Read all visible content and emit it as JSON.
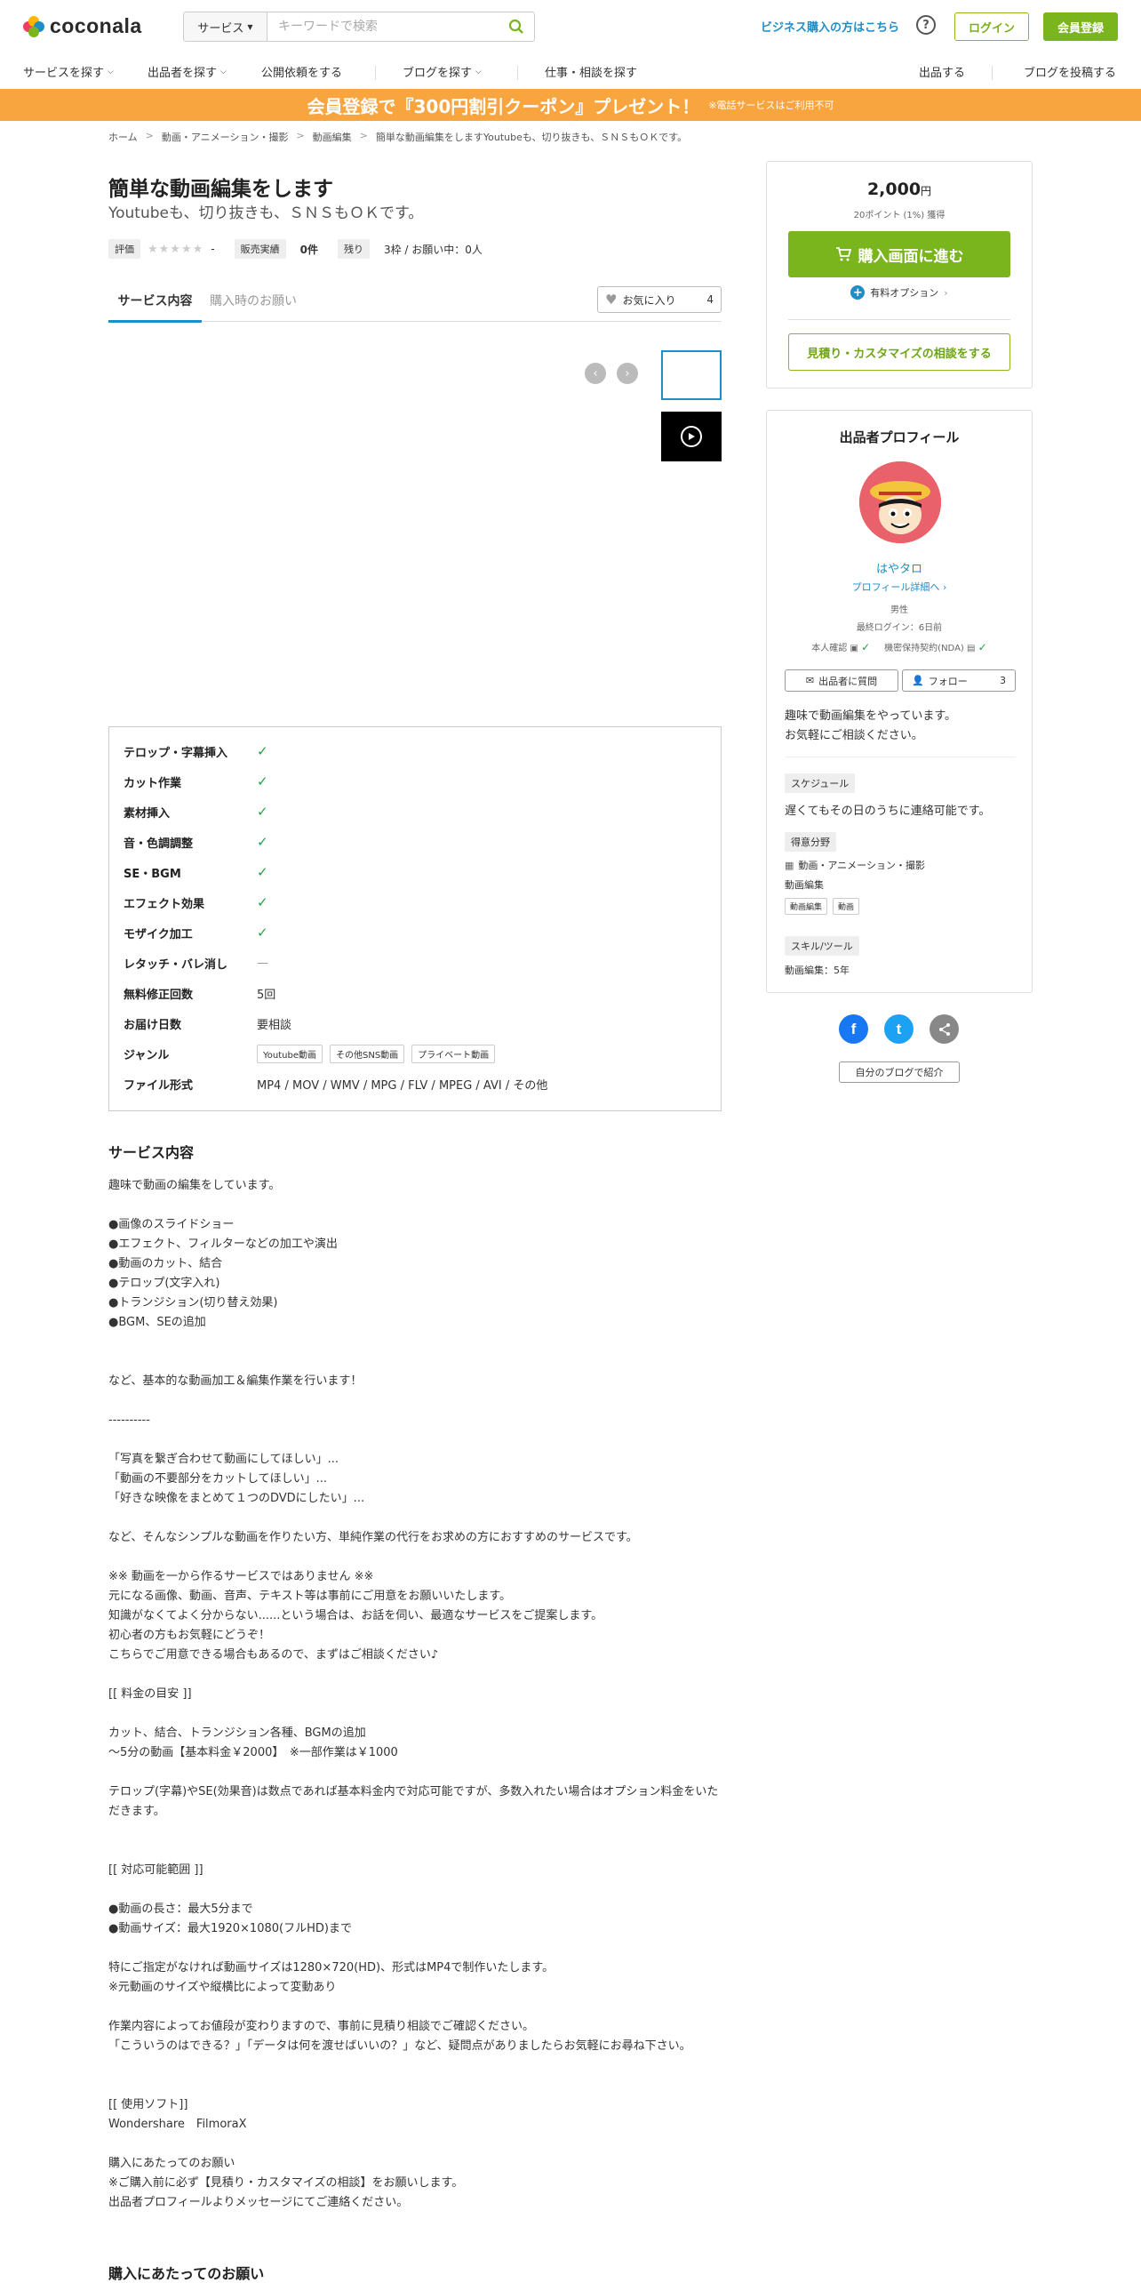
{
  "header": {
    "logo_text": "coconala",
    "search_category": "サービス",
    "search_placeholder": "キーワードで検索",
    "business_link": "ビジネス購入の方はこちら",
    "help": "?",
    "login": "ログイン",
    "register": "会員登録"
  },
  "nav": {
    "items": [
      "サービスを探す",
      "出品者を探す",
      "公開依頼をする",
      "ブログを探す",
      "仕事・相談を探す",
      "出品する",
      "ブログを投稿する"
    ]
  },
  "banner": {
    "main": "会員登録で『300円割引クーポン』プレゼント！",
    "note": "※電話サービスはご利用不可"
  },
  "breadcrumb": [
    "ホーム",
    "動画・アニメーション・撮影",
    "動画編集",
    "簡単な動画編集をしますYoutubeも、切り抜きも、ＳＮＳもＯＫです。"
  ],
  "service": {
    "title": "簡単な動画編集をします",
    "subtitle": "Youtubeも、切り抜きも、ＳＮＳもＯＫです。",
    "rating_label": "評価",
    "stars": "★★★★★",
    "rating_value": "-",
    "sales_label": "販売実績",
    "sales_value": "0件",
    "remaining_label": "残り",
    "remaining_value": "3枠 / お願い中：0人"
  },
  "tabs": {
    "active": "サービス内容",
    "inactive": "購入時のお願い",
    "favorite": "お気に入り",
    "favorite_count": "4"
  },
  "spec": [
    {
      "key": "テロップ・字幕挿入",
      "val": "✓"
    },
    {
      "key": "カット作業",
      "val": "✓"
    },
    {
      "key": "素材挿入",
      "val": "✓"
    },
    {
      "key": "音・色調調整",
      "val": "✓"
    },
    {
      "key": "SE・BGM",
      "val": "✓"
    },
    {
      "key": "エフェクト効果",
      "val": "✓"
    },
    {
      "key": "モザイク加工",
      "val": "✓"
    },
    {
      "key": "レタッチ・バレ消し",
      "val": "—"
    },
    {
      "key": "無料修正回数",
      "val": "5回"
    },
    {
      "key": "お届け日数",
      "val": "要相談"
    },
    {
      "key": "ジャンル",
      "tags": [
        "Youtube動画",
        "その他SNS動画",
        "プライベート動画"
      ]
    },
    {
      "key": "ファイル形式",
      "val": "MP4 / MOV / WMV / MPG / FLV / MPEG / AVI / その他"
    }
  ],
  "description": {
    "heading": "サービス内容",
    "body": "趣味で動画の編集をしています。\n\n●画像のスライドショー\n●エフェクト、フィルターなどの加工や演出\n●動画のカット、結合\n●テロップ(文字入れ)\n●トランジション(切り替え効果)\n●BGM、SEの追加\n\n\nなど、基本的な動画加工＆編集作業を行います！\n\n----------\n\n「写真を繋ぎ合わせて動画にしてほしい」...\n「動画の不要部分をカットしてほしい」...\n「好きな映像をまとめて１つのDVDにしたい」...\n\nなど、そんなシンプルな動画を作りたい方、単純作業の代行をお求めの方におすすめのサービスです。\n\n※※ 動画を一から作るサービスではありません ※※\n元になる画像、動画、音声、テキスト等は事前にご用意をお願いいたします。\n知識がなくてよく分からない......という場合は、お話を伺い、最適なサービスをご提案します。\n初心者の方もお気軽にどうぞ！\nこちらでご用意できる場合もあるので、まずはご相談ください♪\n\n[[ 料金の目安 ]]\n\nカット、結合、トランジション各種、BGMの追加\n～5分の動画【基本料金￥2000】　※一部作業は￥1000\n\nテロップ(字幕)やSE(効果音)は数点であれば基本料金内で対応可能ですが、多数入れたい場合はオプション料金をいただきます。\n\n\n[[ 対応可能範囲 ]]\n\n●動画の長さ：最大5分まで\n●動画サイズ：最大1920×1080(フルHD)まで\n\n特にご指定がなければ動画サイズは1280×720(HD)、形式はMP4で制作いたします。\n※元動画のサイズや縦横比によって変動あり\n\n作業内容によってお値段が変わりますので、事前に見積り相談でご確認ください。\n「こういうのはできる？」「データは何を渡せばいいの？」など、疑問点がありましたらお気軽にお尋ね下さい。\n\n\n[[ 使用ソフト]]\nWondershare　FilmoraX\n\n購入にあたってのお願い\n※ご購入前に必ず【見積り・カスタマイズの相談】をお願いします。\n出品者プロフィールよりメッセージにてご連絡ください。",
    "heading_2": "購入にあたってのお願い"
  },
  "purchase": {
    "price": "2,000",
    "yen": "円",
    "points": "20ポイント (1%) 獲得",
    "buy_button": "購入画面に進む",
    "options": "有料オプション",
    "consult_button": "見積り・カスタマイズの相談をする"
  },
  "profile": {
    "heading": "出品者プロフィール",
    "name": "はやタロ",
    "detail_link": "プロフィール詳細へ",
    "gender": "男性",
    "last_login": "最終ログイン：6日前",
    "identity": "本人確認",
    "nda": "機密保持契約(NDA)",
    "ask_button": "出品者に質問",
    "follow_button": "フォロー",
    "follow_count": "3",
    "intro": "趣味で動画編集をやっています。\nお気軽にご相談ください。",
    "schedule_label": "スケジュール",
    "schedule_text": "遅くてもその日のうちに連絡可能です。",
    "skills_label": "得意分野",
    "skills_category": "動画・アニメーション・撮影",
    "skills_sub": "動画編集",
    "skills_tags": [
      "動画編集",
      "動画"
    ],
    "tools_label": "スキル/ツール",
    "tools_text": "動画編集：5年"
  },
  "social": {
    "facebook": "f",
    "twitter": "t",
    "share": "share",
    "blog_button": "自分のブログで紹介"
  },
  "colors": {
    "green": "#7ab51d",
    "blue": "#1f8dc8",
    "orange": "#f9a53f"
  }
}
